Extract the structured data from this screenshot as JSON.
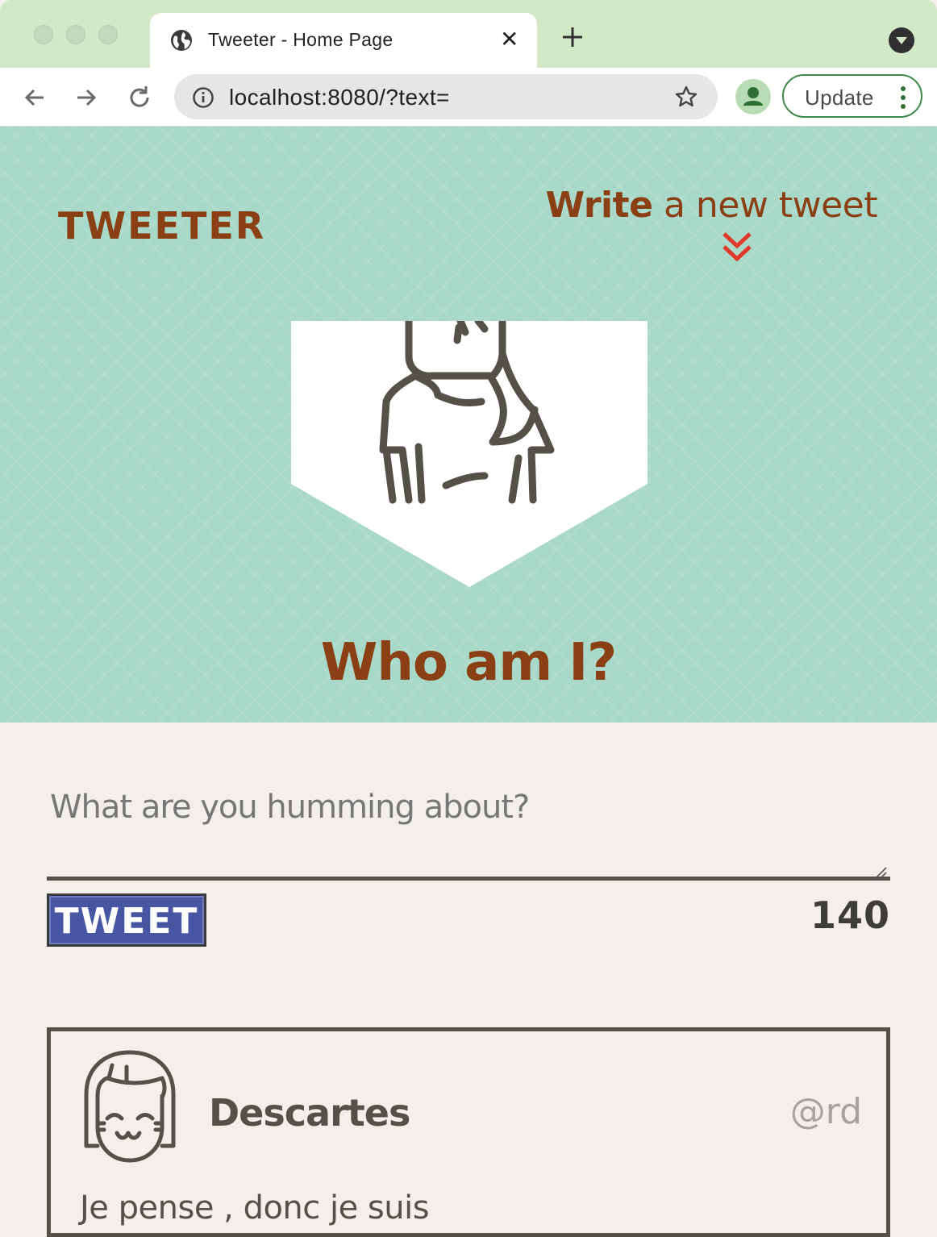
{
  "browser": {
    "tab_title": "Tweeter - Home Page",
    "address": "localhost:8080/?text=",
    "update_label": "Update"
  },
  "nav": {
    "brand": "TWEETER",
    "compose_strong": "Write",
    "compose_rest": " a new tweet"
  },
  "profile": {
    "title": "Who am I?"
  },
  "compose": {
    "placeholder": "What are you humming about?",
    "button_label": "TWEET",
    "counter": "140"
  },
  "tweets": [
    {
      "name": "Descartes",
      "handle": "@rd",
      "text": "Je pense , donc je suis"
    }
  ],
  "colors": {
    "header_bg": "#a8d8c8",
    "brand": "#8a3f14",
    "accent_chevron": "#e0392b",
    "button": "#4656a3",
    "page_bg": "#f3f0eb",
    "ink": "#545149"
  }
}
